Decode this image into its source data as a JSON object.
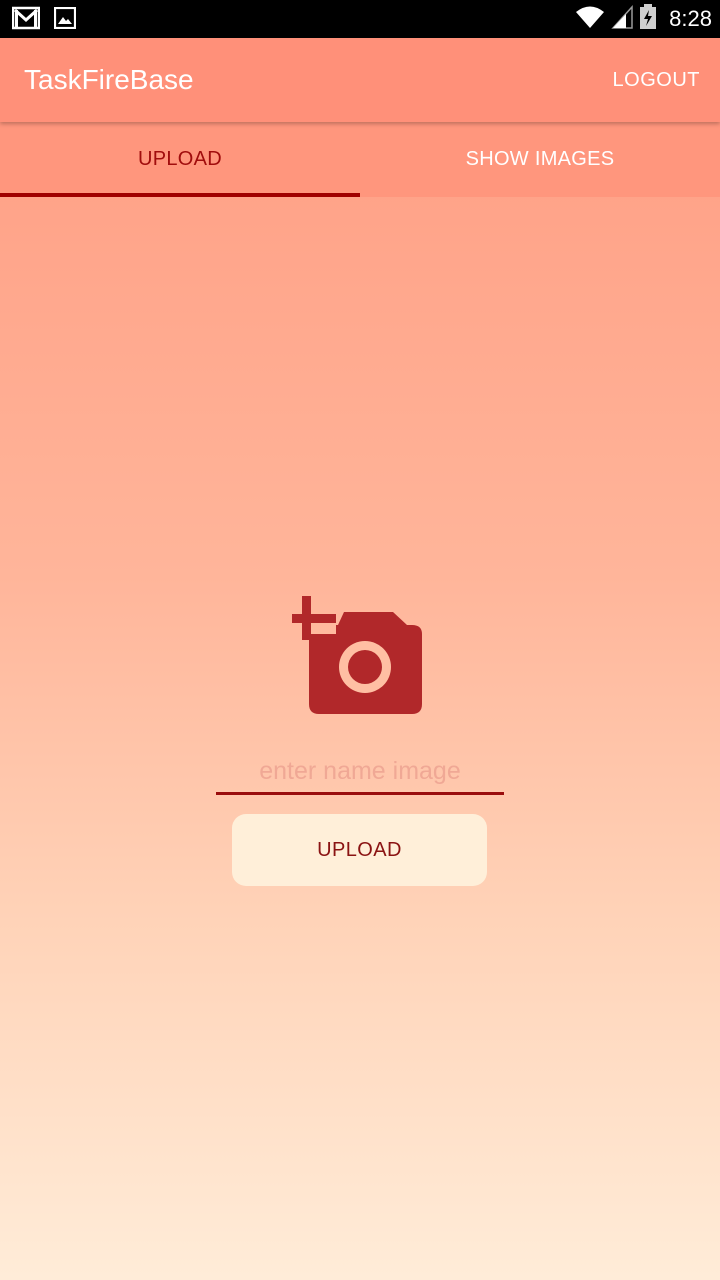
{
  "status_bar": {
    "time": "8:28",
    "icons": [
      "gmail-icon",
      "gallery-icon",
      "wifi-icon",
      "signal-icon",
      "battery-icon"
    ]
  },
  "app_bar": {
    "title": "TaskFireBase",
    "logout_label": "LOGOUT"
  },
  "tabs": [
    {
      "label": "UPLOAD",
      "active": true
    },
    {
      "label": "SHOW IMAGES",
      "active": false
    }
  ],
  "upload_form": {
    "camera_icon": "add-photo-camera-icon",
    "name_input": {
      "value": "",
      "placeholder": "enter name image"
    },
    "upload_button_label": "UPLOAD"
  },
  "colors": {
    "app_bar": "#ff9079",
    "tab_bar": "#ff967d",
    "active_tab_text": "#a10d0d",
    "tab_indicator": "#a00000",
    "camera_icon": "#b1282a",
    "button_background": "#ffefd9",
    "button_text": "#8a1313",
    "gradient_bottom": "#ffecd8"
  }
}
